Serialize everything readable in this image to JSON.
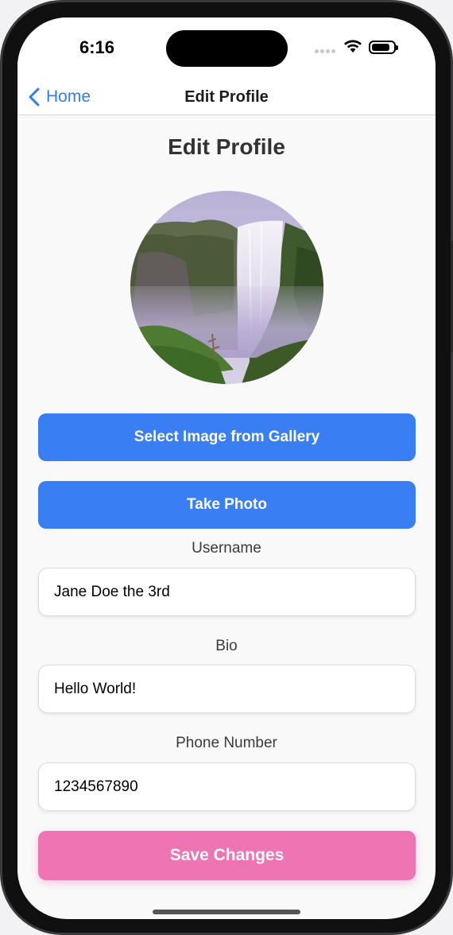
{
  "status_bar": {
    "time": "6:16"
  },
  "nav": {
    "back_label": "Home",
    "title": "Edit Profile"
  },
  "page": {
    "title": "Edit Profile"
  },
  "buttons": {
    "select_gallery": "Select Image from Gallery",
    "take_photo": "Take Photo",
    "save": "Save Changes"
  },
  "fields": {
    "username": {
      "label": "Username",
      "value": "Jane Doe the 3rd"
    },
    "bio": {
      "label": "Bio",
      "value": "Hello World!"
    },
    "phone": {
      "label": "Phone Number",
      "value": "1234567890"
    }
  },
  "colors": {
    "accent_blue": "#3a7ef3",
    "link_blue": "#2f7cf6",
    "save_pink": "#ee74b3",
    "background": "#f9f9f9"
  }
}
